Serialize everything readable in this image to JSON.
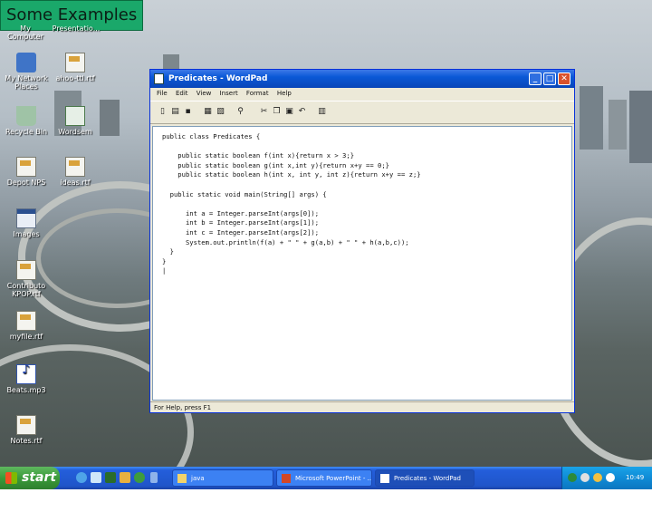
{
  "slide_title": "Some Examples",
  "desktop": {
    "top_labels": [
      "My Computer",
      "Presentatio..."
    ],
    "icons": [
      {
        "label": "My Network Places",
        "icon": "network-places-icon"
      },
      {
        "label": "ahoo-ttl.rtf",
        "icon": "document-icon"
      },
      {
        "label": "Recycle Bin",
        "icon": "recycle-bin-icon"
      },
      {
        "label": "Wordsem",
        "icon": "spreadsheet-icon"
      },
      {
        "label": "Depot NPS",
        "icon": "shortcut-icon"
      },
      {
        "label": "ideas.rtf",
        "icon": "document-icon"
      },
      {
        "label": "Images",
        "icon": "folder-window-icon"
      },
      {
        "label": "Contributo KPOP.rtf",
        "icon": "document-icon"
      },
      {
        "label": "myfile.rtf",
        "icon": "document-icon"
      },
      {
        "label": "Beats.mp3",
        "icon": "music-file-icon"
      },
      {
        "label": "Notes.rtf",
        "icon": "document-icon"
      }
    ]
  },
  "window": {
    "title": "Predicates - WordPad",
    "menu": [
      "File",
      "Edit",
      "View",
      "Insert",
      "Format",
      "Help"
    ],
    "code_lines": [
      "public class Predicates {",
      "",
      "    public static boolean f(int x){return x > 3;}",
      "    public static boolean g(int x,int y){return x+y == 0;}",
      "    public static boolean h(int x, int y, int z){return x+y == z;}",
      "",
      "  public static void main(String[] args) {",
      "",
      "      int a = Integer.parseInt(args[0]);",
      "      int b = Integer.parseInt(args[1]);",
      "      int c = Integer.parseInt(args[2]);",
      "      System.out.println(f(a) + \" \" + g(a,b) + \" \" + h(a,b,c));",
      "  }",
      "}",
      "|"
    ],
    "status": "For Help, press F1"
  },
  "taskbar": {
    "start_label": "start",
    "tasks": [
      {
        "label": "java",
        "active": false
      },
      {
        "label": "Microsoft PowerPoint - ...",
        "active": false
      },
      {
        "label": "Predicates - WordPad",
        "active": true
      }
    ],
    "clock": "10:49 PM"
  },
  "colors": {
    "title_badge_bg": "#1aa86a",
    "window_titlebar": "#0a58d6",
    "taskbar": "#245edb",
    "start_button": "#3a9a3a"
  }
}
